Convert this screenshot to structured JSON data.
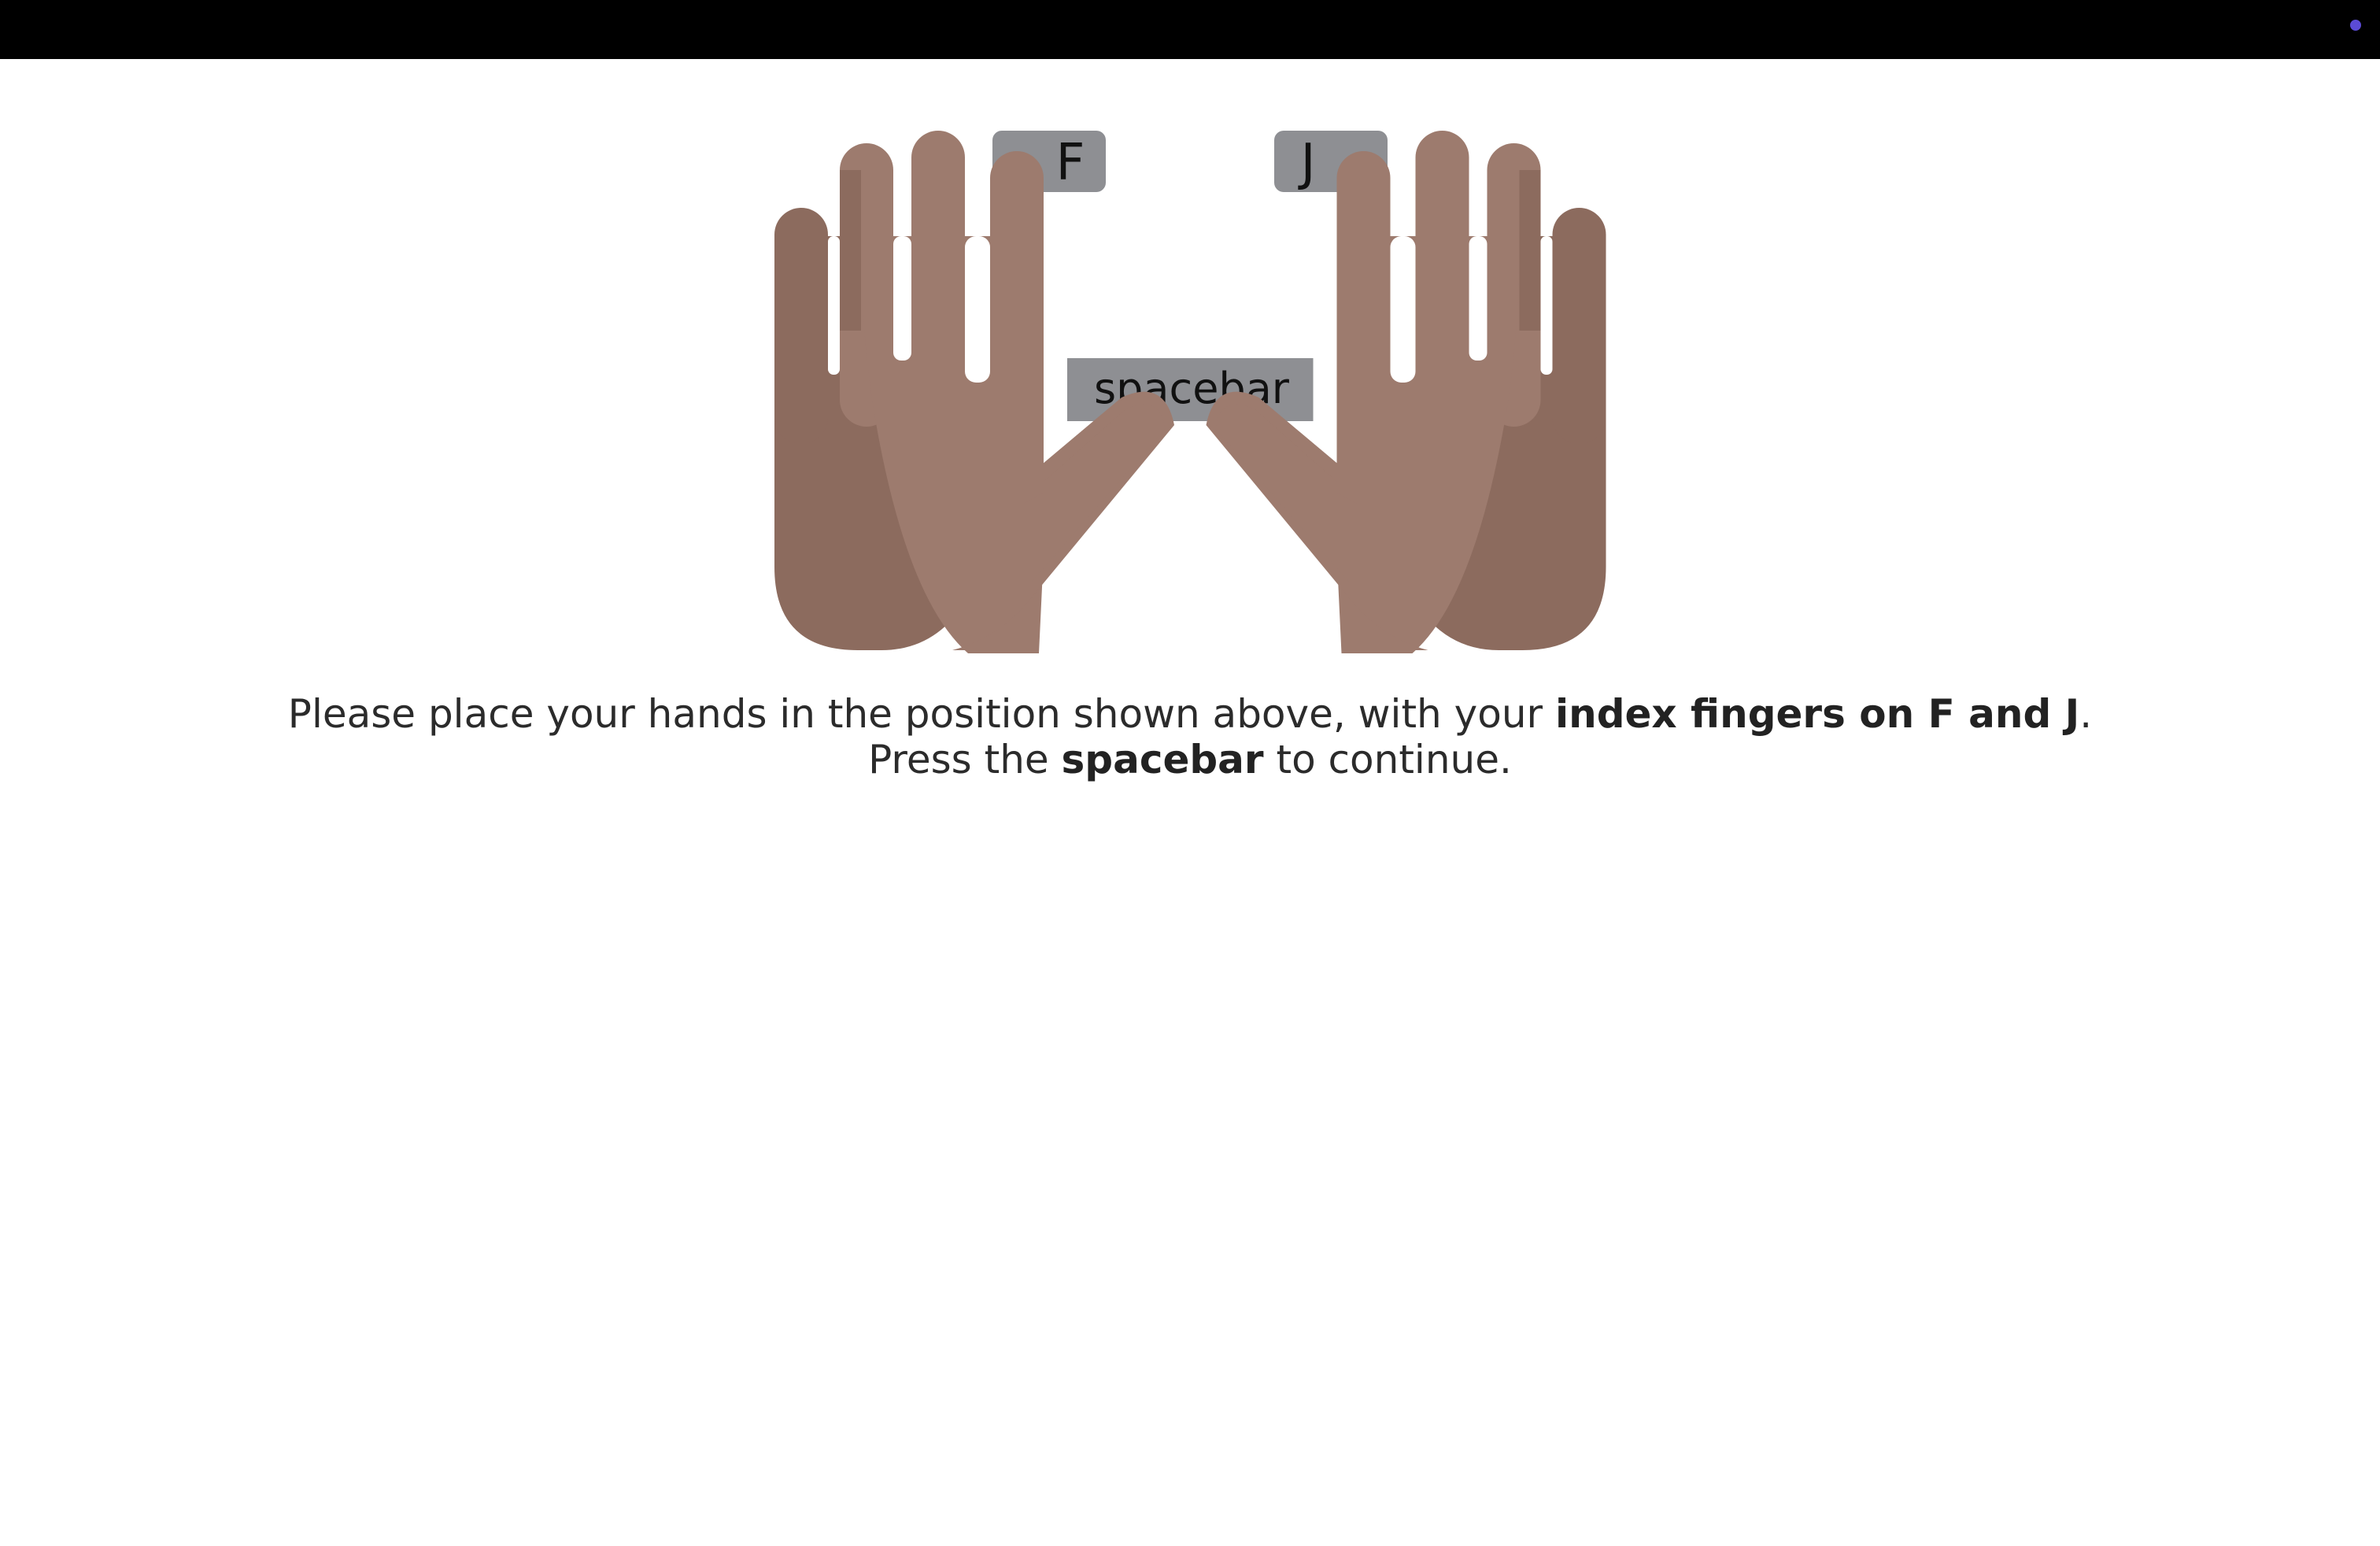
{
  "header": {
    "status_dot_color": "#5b4bd6"
  },
  "illustration": {
    "key_f": "F",
    "key_j": "J",
    "key_spacebar": "spacebar",
    "skin_dark": "#8c6b5e",
    "skin_light": "#9d7b6e",
    "key_color": "#8e8f93"
  },
  "instructions": {
    "line1_prefix": "Please place your hands in the position shown above, with your ",
    "line1_bold": "index fingers on F and J",
    "line1_suffix": ".",
    "line2_prefix": "Press the ",
    "line2_bold": "spacebar",
    "line2_suffix": " to continue."
  }
}
